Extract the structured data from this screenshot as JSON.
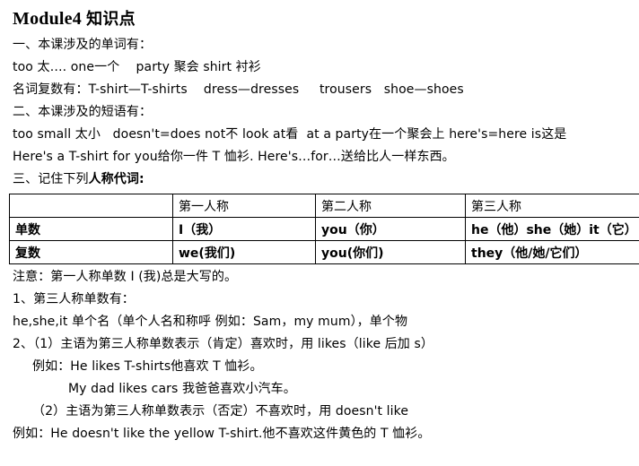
{
  "document": {
    "title_en": "Module4",
    "title_cn": "知识点"
  },
  "sections": {
    "s1_heading": "一、本课涉及的单词有：",
    "s1_line1": "too 太…. one一个    party 聚会 shirt 衬衫",
    "s1_line2": "名词复数有：T-shirt—T-shirts    dress—dresses     trousers   shoe—shoes",
    "s2_heading": "二、本课涉及的短语有：",
    "s2_line1": "too small 太小   doesn't=does not不 look at看  at a party在一个聚会上 here's=here is这是",
    "s2_line2": "Here's a T-shirt for you给你一件 T 恤衫. Here's…for…送给比人一样东西。",
    "s3_heading_prefix": "三、记住下列",
    "s3_heading_bold": "人称代词:",
    "note_line": "注意：第一人称单数 I (我)总是大写的。",
    "rule1_heading": "1、第三人称单数有：",
    "rule1_line": "he,she,it 单个名（单个人名和称呼 例如：Sam，my mum），单个物",
    "rule2_heading": "2、（1）主语为第三人称单数表示（肯定）喜欢时，用 likes（like 后加 s）",
    "rule2_ex1": "例如：He likes T-shirts他喜欢 T 恤衫。",
    "rule2_ex2": "My dad likes cars 我爸爸喜欢小汽车。",
    "rule3_heading": "（2）主语为第三人称单数表示（否定）不喜欢时，用 doesn't like",
    "rule3_ex1": "例如：He doesn't like the yellow T-shirt.他不喜欢这件黄色的 T 恤衫。"
  },
  "table": {
    "header": [
      "",
      "第一人称",
      "第二人称",
      "第三人称"
    ],
    "rows": [
      {
        "label": "单数",
        "first": "I（我）",
        "second": "you（你）",
        "third": "he（他）she（她）it（它）"
      },
      {
        "label": "复数",
        "first": "we(我们)",
        "second": "you(你们)",
        "third": "they（他/她/它们）"
      }
    ]
  }
}
